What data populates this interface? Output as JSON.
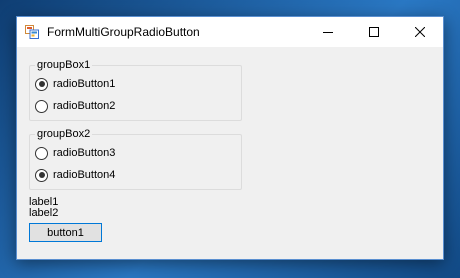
{
  "window": {
    "title": "FormMultiGroupRadioButton",
    "icon": "form-app-icon",
    "caption_buttons": [
      "minimize-icon",
      "maximize-icon",
      "close-icon"
    ]
  },
  "group_boxes": [
    {
      "title": "groupBox1",
      "radios": [
        {
          "label": "radioButton1",
          "checked": true
        },
        {
          "label": "radioButton2",
          "checked": false
        }
      ]
    },
    {
      "title": "groupBox2",
      "radios": [
        {
          "label": "radioButton3",
          "checked": false
        },
        {
          "label": "radioButton4",
          "checked": true
        }
      ]
    }
  ],
  "labels": [
    "label1",
    "label2"
  ],
  "button": {
    "label": "button1"
  },
  "colors": {
    "desktop": "#1e5a94",
    "window_bg": "#f0f0f0",
    "titlebar_bg": "#ffffff",
    "focus_border": "#0078d7",
    "group_border": "#dcdcdc"
  }
}
